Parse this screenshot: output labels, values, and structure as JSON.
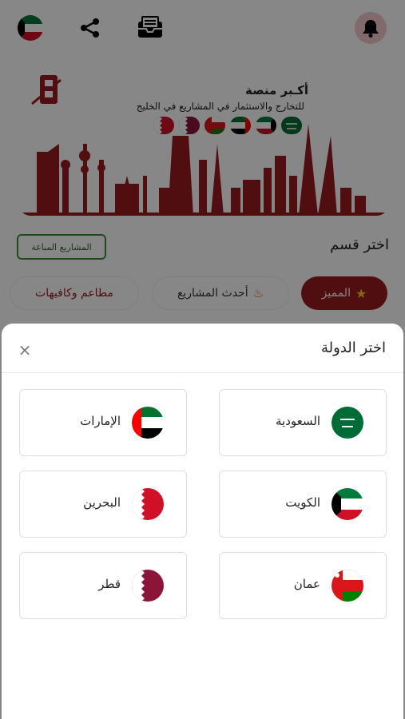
{
  "banner": {
    "title": "أكـبر منصة",
    "subtitle": "للتخارج والاستثمار في المشاريع في الخليج"
  },
  "section": {
    "title": "اختر قسم",
    "sold_projects_label": "المشاريع المباعة"
  },
  "chips": {
    "featured": "المميز",
    "latest": "أحدث المشاريع",
    "restaurants": "مطاعم وكافيهات"
  },
  "country_sheet": {
    "title": "اختر الدولة",
    "close_symbol": "×",
    "countries": [
      {
        "label": "السعودية",
        "flag": "saudi-flag-icon"
      },
      {
        "label": "الإمارات",
        "flag": "uae-flag-icon"
      },
      {
        "label": "الكويت",
        "flag": "kuwait-flag-icon"
      },
      {
        "label": "البحرين",
        "flag": "bahrain-flag-icon"
      },
      {
        "label": "عمان",
        "flag": "oman-flag-icon"
      },
      {
        "label": "قطر",
        "flag": "qatar-flag-icon"
      }
    ]
  },
  "colors": {
    "brand_red": "#9a1b20",
    "green_accent": "#3e8a3e"
  }
}
